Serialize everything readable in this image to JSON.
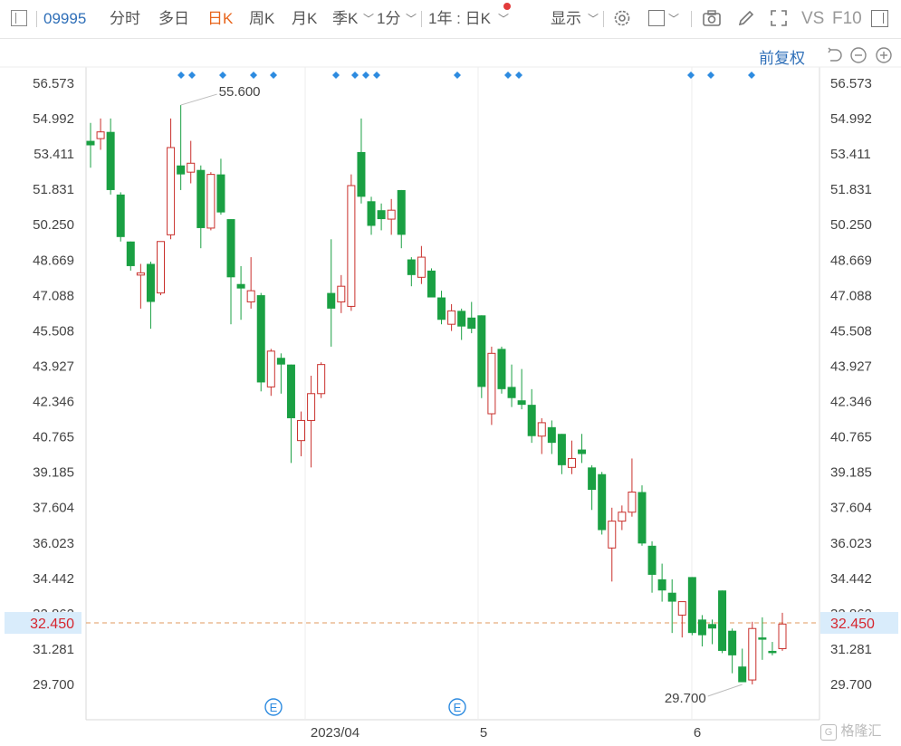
{
  "toolbar": {
    "code": "09995",
    "items": [
      "分时",
      "多日",
      "日K",
      "周K",
      "月K",
      "季K",
      "1分",
      "1年 : 日K",
      "显示",
      "VS",
      "F10"
    ]
  },
  "subbar": {
    "adjust_label": "前复权"
  },
  "colors": {
    "up": "#c9302c",
    "down": "#1aa043",
    "dash": "#e09a5c",
    "price_bg": "#d9ecfb",
    "accent": "#e8641b"
  },
  "chart_data": {
    "type": "candlestick",
    "y_ticks": [
      "56.573",
      "54.992",
      "53.411",
      "51.831",
      "50.250",
      "48.669",
      "47.088",
      "45.508",
      "43.927",
      "42.346",
      "40.765",
      "39.185",
      "37.604",
      "36.023",
      "34.442",
      "32.862",
      "31.281",
      "29.700"
    ],
    "ylim": [
      28.9,
      57.3
    ],
    "x_labels": [
      "2023/04",
      "5",
      "6"
    ],
    "current_price": "32.450",
    "high_marker": "55.600",
    "low_marker": "29.700",
    "event_marker": "E",
    "candles": [
      {
        "o": 54.0,
        "h": 54.8,
        "l": 52.8,
        "c": 53.8
      },
      {
        "o": 54.1,
        "h": 55.0,
        "l": 53.6,
        "c": 54.4
      },
      {
        "o": 54.4,
        "h": 55.0,
        "l": 51.6,
        "c": 51.8
      },
      {
        "o": 51.6,
        "h": 51.7,
        "l": 49.5,
        "c": 49.7
      },
      {
        "o": 49.5,
        "h": 49.5,
        "l": 48.2,
        "c": 48.4
      },
      {
        "o": 48.0,
        "h": 48.5,
        "l": 46.5,
        "c": 48.1
      },
      {
        "o": 48.5,
        "h": 48.6,
        "l": 45.6,
        "c": 46.8
      },
      {
        "o": 47.2,
        "h": 49.5,
        "l": 47.1,
        "c": 49.5
      },
      {
        "o": 49.8,
        "h": 55.0,
        "l": 49.6,
        "c": 53.7
      },
      {
        "o": 52.9,
        "h": 55.6,
        "l": 51.8,
        "c": 52.5
      },
      {
        "o": 52.6,
        "h": 54.0,
        "l": 52.1,
        "c": 53.0
      },
      {
        "o": 52.7,
        "h": 52.9,
        "l": 49.2,
        "c": 50.1
      },
      {
        "o": 50.1,
        "h": 52.6,
        "l": 50.0,
        "c": 52.5
      },
      {
        "o": 52.5,
        "h": 53.2,
        "l": 50.7,
        "c": 50.8
      },
      {
        "o": 50.5,
        "h": 50.5,
        "l": 45.8,
        "c": 47.9
      },
      {
        "o": 47.6,
        "h": 48.4,
        "l": 46.0,
        "c": 47.4
      },
      {
        "o": 46.8,
        "h": 48.8,
        "l": 46.5,
        "c": 47.3
      },
      {
        "o": 47.1,
        "h": 47.2,
        "l": 42.8,
        "c": 43.2
      },
      {
        "o": 43.0,
        "h": 44.7,
        "l": 42.6,
        "c": 44.6
      },
      {
        "o": 44.3,
        "h": 44.5,
        "l": 42.7,
        "c": 44.0
      },
      {
        "o": 44.0,
        "h": 44.0,
        "l": 39.6,
        "c": 41.6
      },
      {
        "o": 40.6,
        "h": 41.9,
        "l": 39.9,
        "c": 41.5
      },
      {
        "o": 41.5,
        "h": 43.5,
        "l": 39.4,
        "c": 42.7
      },
      {
        "o": 42.7,
        "h": 44.1,
        "l": 42.5,
        "c": 44.0
      },
      {
        "o": 47.2,
        "h": 49.6,
        "l": 44.8,
        "c": 46.5
      },
      {
        "o": 46.8,
        "h": 48.0,
        "l": 46.3,
        "c": 47.5
      },
      {
        "o": 46.6,
        "h": 52.5,
        "l": 46.4,
        "c": 52.0
      },
      {
        "o": 53.5,
        "h": 55.0,
        "l": 51.2,
        "c": 51.5
      },
      {
        "o": 51.3,
        "h": 51.5,
        "l": 49.8,
        "c": 50.2
      },
      {
        "o": 50.9,
        "h": 51.2,
        "l": 50.0,
        "c": 50.5
      },
      {
        "o": 50.5,
        "h": 51.4,
        "l": 49.8,
        "c": 50.9
      },
      {
        "o": 51.8,
        "h": 51.8,
        "l": 49.2,
        "c": 49.8
      },
      {
        "o": 48.7,
        "h": 48.8,
        "l": 47.5,
        "c": 48.0
      },
      {
        "o": 47.9,
        "h": 49.3,
        "l": 47.6,
        "c": 48.8
      },
      {
        "o": 48.2,
        "h": 48.3,
        "l": 47.2,
        "c": 47.0
      },
      {
        "o": 47.0,
        "h": 47.3,
        "l": 45.8,
        "c": 46.0
      },
      {
        "o": 45.8,
        "h": 46.7,
        "l": 45.5,
        "c": 46.4
      },
      {
        "o": 46.4,
        "h": 46.5,
        "l": 45.1,
        "c": 45.7
      },
      {
        "o": 46.1,
        "h": 46.8,
        "l": 45.4,
        "c": 45.6
      },
      {
        "o": 46.2,
        "h": 46.2,
        "l": 42.5,
        "c": 43.0
      },
      {
        "o": 41.8,
        "h": 44.8,
        "l": 41.3,
        "c": 44.5
      },
      {
        "o": 44.7,
        "h": 44.8,
        "l": 42.7,
        "c": 42.9
      },
      {
        "o": 43.0,
        "h": 44.0,
        "l": 42.1,
        "c": 42.5
      },
      {
        "o": 42.4,
        "h": 43.8,
        "l": 42.0,
        "c": 42.2
      },
      {
        "o": 42.2,
        "h": 42.9,
        "l": 40.5,
        "c": 40.8
      },
      {
        "o": 40.8,
        "h": 41.6,
        "l": 40.0,
        "c": 41.4
      },
      {
        "o": 41.2,
        "h": 41.5,
        "l": 40.0,
        "c": 40.5
      },
      {
        "o": 40.9,
        "h": 40.9,
        "l": 39.1,
        "c": 39.5
      },
      {
        "o": 39.4,
        "h": 40.6,
        "l": 39.1,
        "c": 39.8
      },
      {
        "o": 40.2,
        "h": 40.9,
        "l": 39.6,
        "c": 40.0
      },
      {
        "o": 39.4,
        "h": 39.5,
        "l": 37.5,
        "c": 38.4
      },
      {
        "o": 39.1,
        "h": 39.2,
        "l": 36.4,
        "c": 36.6
      },
      {
        "o": 35.8,
        "h": 37.6,
        "l": 34.3,
        "c": 37.0
      },
      {
        "o": 37.0,
        "h": 37.7,
        "l": 36.6,
        "c": 37.4
      },
      {
        "o": 37.4,
        "h": 39.8,
        "l": 37.2,
        "c": 38.3
      },
      {
        "o": 38.3,
        "h": 38.6,
        "l": 35.9,
        "c": 36.0
      },
      {
        "o": 35.9,
        "h": 36.1,
        "l": 33.8,
        "c": 34.6
      },
      {
        "o": 34.4,
        "h": 35.1,
        "l": 33.4,
        "c": 33.9
      },
      {
        "o": 33.8,
        "h": 34.4,
        "l": 32.0,
        "c": 33.4
      },
      {
        "o": 32.8,
        "h": 33.4,
        "l": 31.8,
        "c": 33.4
      },
      {
        "o": 34.5,
        "h": 34.5,
        "l": 31.9,
        "c": 32.0
      },
      {
        "o": 32.6,
        "h": 32.8,
        "l": 31.4,
        "c": 31.9
      },
      {
        "o": 32.4,
        "h": 32.6,
        "l": 31.5,
        "c": 32.2
      },
      {
        "o": 33.9,
        "h": 33.9,
        "l": 31.1,
        "c": 31.2
      },
      {
        "o": 32.1,
        "h": 32.2,
        "l": 30.2,
        "c": 31.0
      },
      {
        "o": 30.5,
        "h": 31.3,
        "l": 29.8,
        "c": 29.8
      },
      {
        "o": 29.9,
        "h": 32.5,
        "l": 29.7,
        "c": 32.2
      },
      {
        "o": 31.8,
        "h": 32.7,
        "l": 30.8,
        "c": 31.7
      },
      {
        "o": 31.2,
        "h": 31.6,
        "l": 31.0,
        "c": 31.1
      },
      {
        "o": 31.3,
        "h": 32.9,
        "l": 31.2,
        "c": 32.4
      }
    ]
  }
}
